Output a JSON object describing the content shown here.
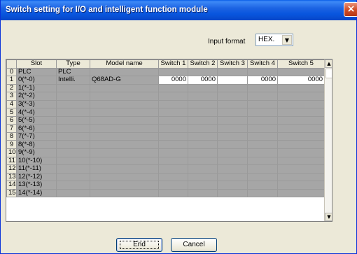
{
  "window": {
    "title": "Switch setting for I/O and intelligent function module",
    "close_symbol": "×"
  },
  "input_format": {
    "label": "Input format",
    "value": "HEX."
  },
  "grid": {
    "headers": [
      "",
      "Slot",
      "Type",
      "Model name",
      "Switch 1",
      "Switch 2",
      "Switch 3",
      "Switch 4",
      "Switch 5"
    ],
    "rows": [
      {
        "no": "0",
        "slot": "PLC",
        "type": "PLC",
        "model": "",
        "sw1": "",
        "sw2": "",
        "sw3": "",
        "sw4": "",
        "sw5": ""
      },
      {
        "no": "1",
        "slot": "0(*-0)",
        "type": "Intelli.",
        "model": "Q68AD-G",
        "sw1": "0000",
        "sw2": "0000",
        "sw3": "",
        "sw4": "0000",
        "sw5": "0000"
      },
      {
        "no": "2",
        "slot": "1(*-1)",
        "type": "",
        "model": "",
        "sw1": "",
        "sw2": "",
        "sw3": "",
        "sw4": "",
        "sw5": ""
      },
      {
        "no": "3",
        "slot": "2(*-2)",
        "type": "",
        "model": "",
        "sw1": "",
        "sw2": "",
        "sw3": "",
        "sw4": "",
        "sw5": ""
      },
      {
        "no": "4",
        "slot": "3(*-3)",
        "type": "",
        "model": "",
        "sw1": "",
        "sw2": "",
        "sw3": "",
        "sw4": "",
        "sw5": ""
      },
      {
        "no": "5",
        "slot": "4(*-4)",
        "type": "",
        "model": "",
        "sw1": "",
        "sw2": "",
        "sw3": "",
        "sw4": "",
        "sw5": ""
      },
      {
        "no": "6",
        "slot": "5(*-5)",
        "type": "",
        "model": "",
        "sw1": "",
        "sw2": "",
        "sw3": "",
        "sw4": "",
        "sw5": ""
      },
      {
        "no": "7",
        "slot": "6(*-6)",
        "type": "",
        "model": "",
        "sw1": "",
        "sw2": "",
        "sw3": "",
        "sw4": "",
        "sw5": ""
      },
      {
        "no": "8",
        "slot": "7(*-7)",
        "type": "",
        "model": "",
        "sw1": "",
        "sw2": "",
        "sw3": "",
        "sw4": "",
        "sw5": ""
      },
      {
        "no": "9",
        "slot": "8(*-8)",
        "type": "",
        "model": "",
        "sw1": "",
        "sw2": "",
        "sw3": "",
        "sw4": "",
        "sw5": ""
      },
      {
        "no": "10",
        "slot": "9(*-9)",
        "type": "",
        "model": "",
        "sw1": "",
        "sw2": "",
        "sw3": "",
        "sw4": "",
        "sw5": ""
      },
      {
        "no": "11",
        "slot": "10(*-10)",
        "type": "",
        "model": "",
        "sw1": "",
        "sw2": "",
        "sw3": "",
        "sw4": "",
        "sw5": ""
      },
      {
        "no": "12",
        "slot": "11(*-11)",
        "type": "",
        "model": "",
        "sw1": "",
        "sw2": "",
        "sw3": "",
        "sw4": "",
        "sw5": ""
      },
      {
        "no": "13",
        "slot": "12(*-12)",
        "type": "",
        "model": "",
        "sw1": "",
        "sw2": "",
        "sw3": "",
        "sw4": "",
        "sw5": ""
      },
      {
        "no": "14",
        "slot": "13(*-13)",
        "type": "",
        "model": "",
        "sw1": "",
        "sw2": "",
        "sw3": "",
        "sw4": "",
        "sw5": ""
      },
      {
        "no": "15",
        "slot": "14(*-14)",
        "type": "",
        "model": "",
        "sw1": "",
        "sw2": "",
        "sw3": "",
        "sw4": "",
        "sw5": ""
      }
    ]
  },
  "scrollbar": {
    "up_symbol": "▲",
    "down_symbol": "▼"
  },
  "dropdown_symbol": "▼",
  "buttons": {
    "end_label": "End",
    "cancel_label": "Cancel"
  },
  "colors": {
    "title_bar": "#0855dd",
    "unused_cell": "#a6a6a6",
    "editable_cell": "#ffffff",
    "close_button": "#d24f28"
  }
}
